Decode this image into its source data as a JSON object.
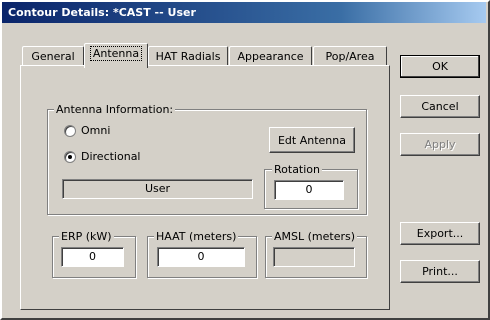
{
  "window": {
    "title": "Contour Details: *CAST -- User"
  },
  "tabs": [
    {
      "label": "General"
    },
    {
      "label": "Antenna"
    },
    {
      "label": "HAT Radials"
    },
    {
      "label": "Appearance"
    },
    {
      "label": "Pop/Area"
    }
  ],
  "active_tab": "Antenna",
  "antenna_info": {
    "legend": "Antenna Information:",
    "omni_label": "Omni",
    "directional_label": "Directional",
    "selected": "Directional",
    "edit_button": "Edt Antenna",
    "pattern_value": "User",
    "rotation": {
      "legend": "Rotation",
      "value": "0"
    }
  },
  "erp": {
    "legend": "ERP (kW)",
    "value": "0"
  },
  "haat": {
    "legend": "HAAT (meters)",
    "value": "0"
  },
  "amsl": {
    "legend": "AMSL (meters)",
    "value": ""
  },
  "buttons": {
    "ok": "OK",
    "cancel": "Cancel",
    "apply": "Apply",
    "export": "Export...",
    "print": "Print..."
  }
}
